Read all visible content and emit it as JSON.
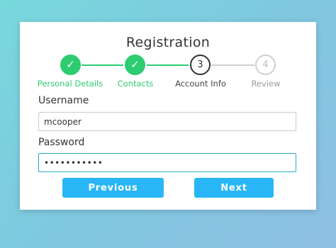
{
  "form": {
    "title": "Registration",
    "steps": [
      {
        "label": "Personal Details",
        "marker": "✓",
        "state": "done"
      },
      {
        "label": "Contacts",
        "marker": "✓",
        "state": "done"
      },
      {
        "label": "Account Info",
        "marker": "3",
        "state": "active"
      },
      {
        "label": "Review",
        "marker": "4",
        "state": "pending"
      }
    ],
    "username_label": "Username",
    "username_value": "mcooper",
    "password_label": "Password",
    "password_value": "•••••••••••",
    "previous_label": "Previous",
    "next_label": "Next"
  },
  "colors": {
    "done": "#2ecc71",
    "active": "#333333",
    "pending": "#cfcfcf",
    "button": "#29b6f6"
  }
}
